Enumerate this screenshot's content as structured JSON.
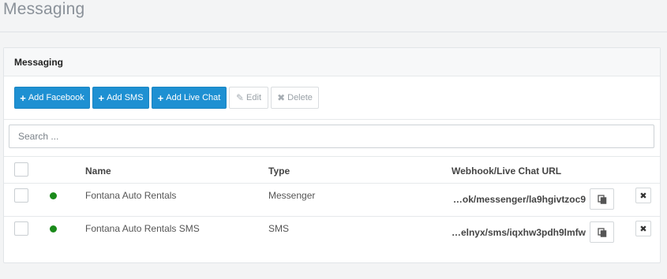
{
  "page": {
    "title": "Messaging"
  },
  "panel": {
    "title": "Messaging",
    "toolbar": {
      "add_facebook": "Add Facebook",
      "add_sms": "Add SMS",
      "add_live_chat": "Add Live Chat",
      "edit": "Edit",
      "delete": "Delete"
    },
    "search": {
      "placeholder": "Search ...",
      "value": ""
    },
    "table": {
      "headers": {
        "name": "Name",
        "type": "Type",
        "url": "Webhook/Live Chat URL"
      },
      "rows": [
        {
          "status": "active",
          "status_color": "#1a8a1a",
          "name": "Fontana Auto Rentals",
          "type": "Messenger",
          "url": "…ok/messenger/la9hgivtzoc9"
        },
        {
          "status": "active",
          "status_color": "#1a8a1a",
          "name": "Fontana Auto Rentals SMS",
          "type": "SMS",
          "url": "…elnyx/sms/iqxhw3pdh9lmfw"
        }
      ]
    }
  },
  "colors": {
    "primary": "#1e90d2",
    "active_dot": "#1a8a1a"
  },
  "icons": [
    "plus-icon",
    "pencil-icon",
    "x-icon",
    "copy-icon",
    "close-icon"
  ]
}
